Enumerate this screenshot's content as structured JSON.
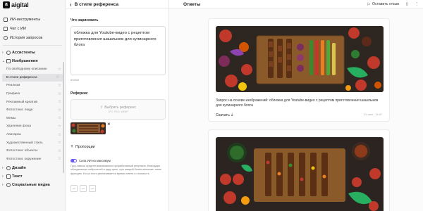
{
  "app": {
    "logo_letter": "a",
    "logo_text": "aigital"
  },
  "sidebar": {
    "top_items": [
      {
        "label": "ИИ-инструменты",
        "icon": "grid-icon"
      },
      {
        "label": "Чат с ИИ",
        "icon": "chat-icon"
      },
      {
        "label": "История запросов",
        "icon": "history-icon"
      }
    ],
    "group_assistants": "Ассистенты",
    "group_images": "Изображения",
    "image_items": [
      {
        "label": "По свободному описанию",
        "active": false
      },
      {
        "label": "В стиле референса",
        "active": true
      },
      {
        "label": "Реализм",
        "active": false
      },
      {
        "label": "Графика",
        "active": false
      },
      {
        "label": "Рекламный креатив",
        "active": false
      },
      {
        "label": "Фотостоки: люди",
        "active": false
      },
      {
        "label": "Мемы",
        "active": false
      },
      {
        "label": "Удаление фона",
        "active": false
      },
      {
        "label": "Аватарка",
        "active": false
      },
      {
        "label": "Художественный стиль",
        "active": false
      },
      {
        "label": "Фотостоки: объекты",
        "active": false
      },
      {
        "label": "Фотостоки: окружение",
        "active": false
      }
    ],
    "group_design": "Дизайн",
    "group_text": "Текст",
    "group_social": "Социальные медиа"
  },
  "middle": {
    "title": "В стиле референса",
    "prompt_label": "Что нарисовать",
    "prompt_value": "обложка для Youtube-видео с рецептом приготовления шашлыков для кулинарного блога",
    "counter": "80/500",
    "reference_label": "Референс",
    "dropzone_text": "Выбрать референс",
    "dropzone_hint": "JPG, PNG, WEBP",
    "proportions_label": "Пропорции",
    "toggle_label": "Сила ИИ на максимум",
    "toggle_on": true,
    "toggle_desc": "Гуру-чавыш средств максимально проработанный результат, благодаря объединению нейросетей в одну цепь, при каждой более включает свою функцию. Из-за этого увеличивается время ответа и стоимость."
  },
  "answers": {
    "title": "Ответы",
    "feedback_label": "Оставить отзыв",
    "card1": {
      "prompt": "Запрос на основе изображений: обложка для Youtube-видео с рецептом приготовления шашлыков для кулинарного блога",
      "download_label": "Скачать",
      "timestamp": "21 июл., 11:57"
    }
  },
  "colors": {
    "accent": "#6d5df5",
    "wood": "#8a5a32",
    "board": "#2b2520"
  }
}
